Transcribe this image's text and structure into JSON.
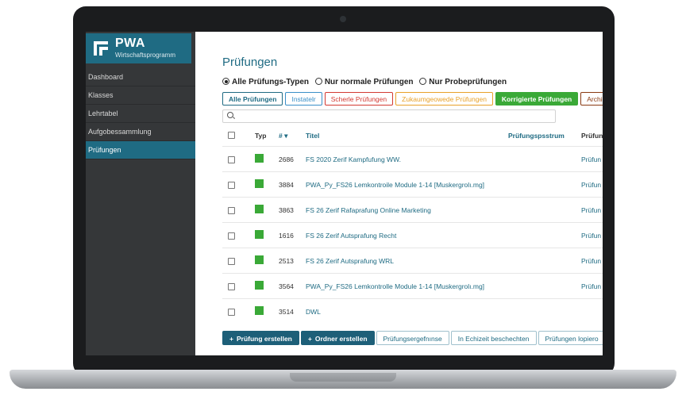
{
  "app": {
    "brand": "PWA",
    "subtitle": "Wirtschaftsprogramm"
  },
  "sidebar": {
    "items": [
      {
        "label": "Dashboard",
        "active": false
      },
      {
        "label": "Klasses",
        "active": false
      },
      {
        "label": "Lehrtabel",
        "active": false
      },
      {
        "label": "Aufgobessammlung",
        "active": false
      },
      {
        "label": "Prüfungen",
        "active": true
      }
    ]
  },
  "page": {
    "title": "Prüfungen"
  },
  "type_filter": {
    "options": [
      "Alle Prüfungs-Typen",
      "Nur normale Prüfungen",
      "Nur Probeprüfungen"
    ],
    "selected": 0
  },
  "filter_buttons": [
    {
      "label": "Alle Prüfungen",
      "color": "#1f6b83"
    },
    {
      "label": "Instatelr",
      "color": "#3a8fc7"
    },
    {
      "label": "Scherle Prüfungen",
      "color": "#d33a32"
    },
    {
      "label": "Zukaumgeowede Prüfungen",
      "color": "#e8a12a"
    },
    {
      "label": "Korrigierte Prüfungen",
      "color": "#3aa937",
      "filled": true
    },
    {
      "label": "Archie",
      "color": "#8a3a12"
    }
  ],
  "search": {
    "placeholder": ""
  },
  "table": {
    "headers": {
      "typ": "Typ",
      "num": "#",
      "sort": "▾",
      "title": "Titel",
      "date": "Prüfungspsstrum",
      "last": "Prüfun"
    },
    "rows": [
      {
        "num": "2686",
        "title": "FS 2020 Zerif Kampfufung WW.",
        "link": "Prüfun"
      },
      {
        "num": "3884",
        "title": "PWA_Py_FS26 Lemkontroile Module 1-14 [Muskergrolı.mg]",
        "link": "Prüfun"
      },
      {
        "num": "3863",
        "title": "FS 26 Zerif Rafaprafung Online Marketing",
        "link": "Prüfun"
      },
      {
        "num": "1616",
        "title": "FS 26 Zerif Autsprafung Recht",
        "link": "Prüfun"
      },
      {
        "num": "2513",
        "title": "FS 26 Zerif Autsprafung WRL",
        "link": "Prüfun"
      },
      {
        "num": "3564",
        "title": "PWA_Py_FS26 Lemkontrolle Module 1-14 [Muskergrolı.mg]",
        "link": "Prüfun"
      },
      {
        "num": "3514",
        "title": "DWL",
        "link": ""
      }
    ]
  },
  "actions": [
    {
      "label": "Prüfung erstellen",
      "style": "dark",
      "plus": "+"
    },
    {
      "label": "Ordner erstellen",
      "style": "dark",
      "plus": "+"
    },
    {
      "label": "Prüfungsergefnınse",
      "style": "light"
    },
    {
      "label": "In Echizeit beschechten",
      "style": "light"
    },
    {
      "label": "Prüfungen lopiero",
      "style": "light"
    }
  ]
}
